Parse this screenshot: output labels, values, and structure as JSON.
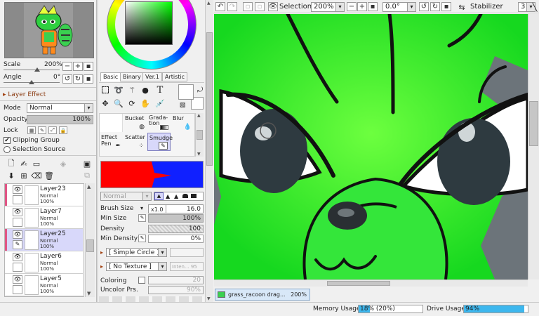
{
  "navigator": {
    "scale_label": "Scale",
    "scale_value": "200%",
    "angle_label": "Angle",
    "angle_value": "0°"
  },
  "layer_effect": {
    "title": "Layer Effect",
    "mode_label": "Mode",
    "mode_value": "Normal",
    "opacity_label": "Opacity",
    "opacity_value": "100%",
    "opacity_fraction": 1.0,
    "lock_label": "Lock",
    "clipping_group_label": "Clipping Group",
    "clipping_group_checked": true,
    "selection_source_label": "Selection Source",
    "selection_source_checked": false
  },
  "layers": [
    {
      "name": "Layer23",
      "mode": "Normal",
      "opacity": "100%",
      "visible": true,
      "selected": false,
      "marker_color": "#e05585"
    },
    {
      "name": "Layer7",
      "mode": "Normal",
      "opacity": "100%",
      "visible": true,
      "selected": false,
      "marker_color": ""
    },
    {
      "name": "Layer25",
      "mode": "Normal",
      "opacity": "100%",
      "visible": true,
      "selected": true,
      "marker_color": "#e05585"
    },
    {
      "name": "Layer6",
      "mode": "Normal",
      "opacity": "100%",
      "visible": true,
      "selected": false,
      "marker_color": ""
    },
    {
      "name": "Layer5",
      "mode": "Normal",
      "opacity": "100%",
      "visible": true,
      "selected": false,
      "marker_color": ""
    }
  ],
  "color_tabs": [
    "Basic",
    "Binary",
    "Ver.1",
    "Artistic"
  ],
  "color_tabs_active": "Basic",
  "brush_tools": {
    "row1": [
      "Bucket",
      "Grada-\ntion",
      "Blur"
    ],
    "row2": [
      "Effect\nPen",
      "Scatter",
      "Smudge"
    ],
    "selected": "Smudge"
  },
  "brush_settings": {
    "blend_mode": "Normal",
    "brush_size_label": "Brush Size",
    "brush_size_mult": "x1.0",
    "brush_size_value": "16.0",
    "min_size_label": "Min Size",
    "min_size_value": "100%",
    "min_size_fraction": 1.0,
    "density_label": "Density",
    "density_value": "100",
    "density_fraction": 1.0,
    "min_density_label": "Min Density",
    "min_density_value": "0%",
    "min_density_fraction": 0.0,
    "shape_value": "[ Simple Circle ]",
    "texture_value": "[ No Texture ]",
    "texture_intensity": "Inten... 95",
    "coloring_label": "Coloring",
    "coloring_value": "20",
    "uncolor_label": "Uncolor Prs.",
    "uncolor_value": "90%"
  },
  "toolbar": {
    "selection_label": "Selection",
    "zoom_value": "200%",
    "rotation_value": "0.0°",
    "stabilizer_label": "Stabilizer",
    "stabilizer_value": "3"
  },
  "document_tab": {
    "name": "grass_racoon drag...",
    "zoom": "200%"
  },
  "status": {
    "memory_label": "Memory Usage",
    "memory_value": "18% (20%)",
    "memory_fraction": 0.18,
    "drive_label": "Drive Usage",
    "drive_value": "94%",
    "drive_fraction": 0.94
  },
  "colors": {
    "canvas_green": "#1ee825",
    "canvas_light_green": "#7dff3c",
    "accent_blue": "#3db7ee",
    "selection_bg": "#d8d8fa",
    "red_swatch": "#ff0000",
    "blue_swatch": "#1020ff"
  }
}
